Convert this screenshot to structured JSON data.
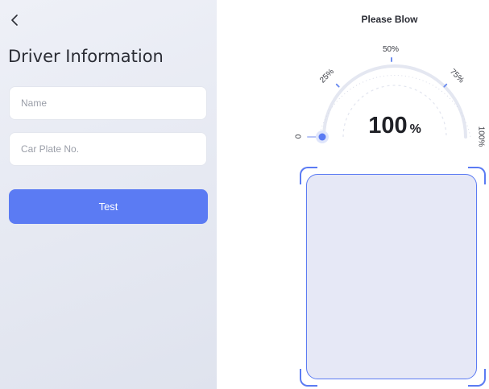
{
  "form": {
    "back_icon": "chevron-left-icon",
    "title": "Driver Information",
    "name_placeholder": "Name",
    "plate_placeholder": "Car Plate No.",
    "test_label": "Test"
  },
  "gauge": {
    "title": "Please Blow",
    "value": "100",
    "unit": "%",
    "level": 0,
    "ticks": [
      "0",
      "25%",
      "50%",
      "75%",
      "100%"
    ]
  },
  "colors": {
    "accent": "#5b7bf3",
    "track": "#e4e7f1",
    "frame_fill": "#e6e8f6"
  }
}
